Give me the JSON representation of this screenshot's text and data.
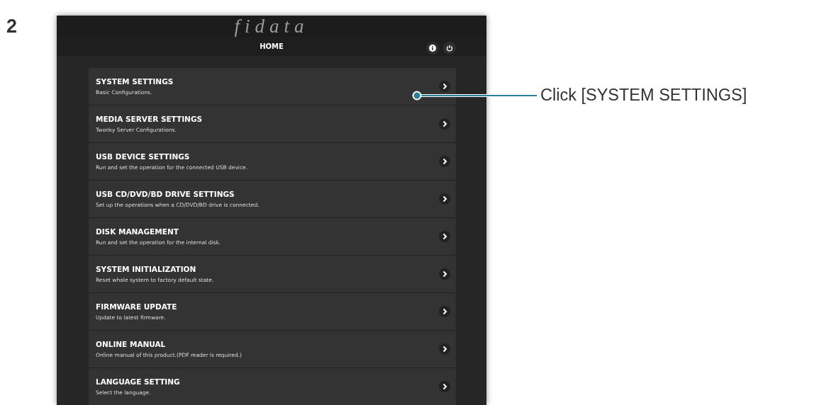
{
  "step": "2",
  "app": {
    "logo": "fidata",
    "title": "HOME",
    "menu": [
      {
        "title": "SYSTEM SETTINGS",
        "description": "Basic Configurations."
      },
      {
        "title": "MEDIA SERVER SETTINGS",
        "description": "Twonky Server Configurations."
      },
      {
        "title": "USB DEVICE SETTINGS",
        "description": "Run and set the operation for the connected USB device."
      },
      {
        "title": "USB CD/DVD/BD DRIVE SETTINGS",
        "description": "Set up the operations when a CD/DVD/BD drive is connected."
      },
      {
        "title": "DISK MANAGEMENT",
        "description": "Run and set the operation for the internal disk."
      },
      {
        "title": "SYSTEM INITIALIZATION",
        "description": "Reset whole system to factory default state."
      },
      {
        "title": "FIRMWARE UPDATE",
        "description": "Update to latest firmware."
      },
      {
        "title": "ONLINE MANUAL",
        "description": "Online manual of this product.(PDF reader is required.)"
      },
      {
        "title": "LANGUAGE SETTING",
        "description": "Select the language."
      }
    ]
  },
  "callout": {
    "text": "Click [SYSTEM SETTINGS]"
  }
}
